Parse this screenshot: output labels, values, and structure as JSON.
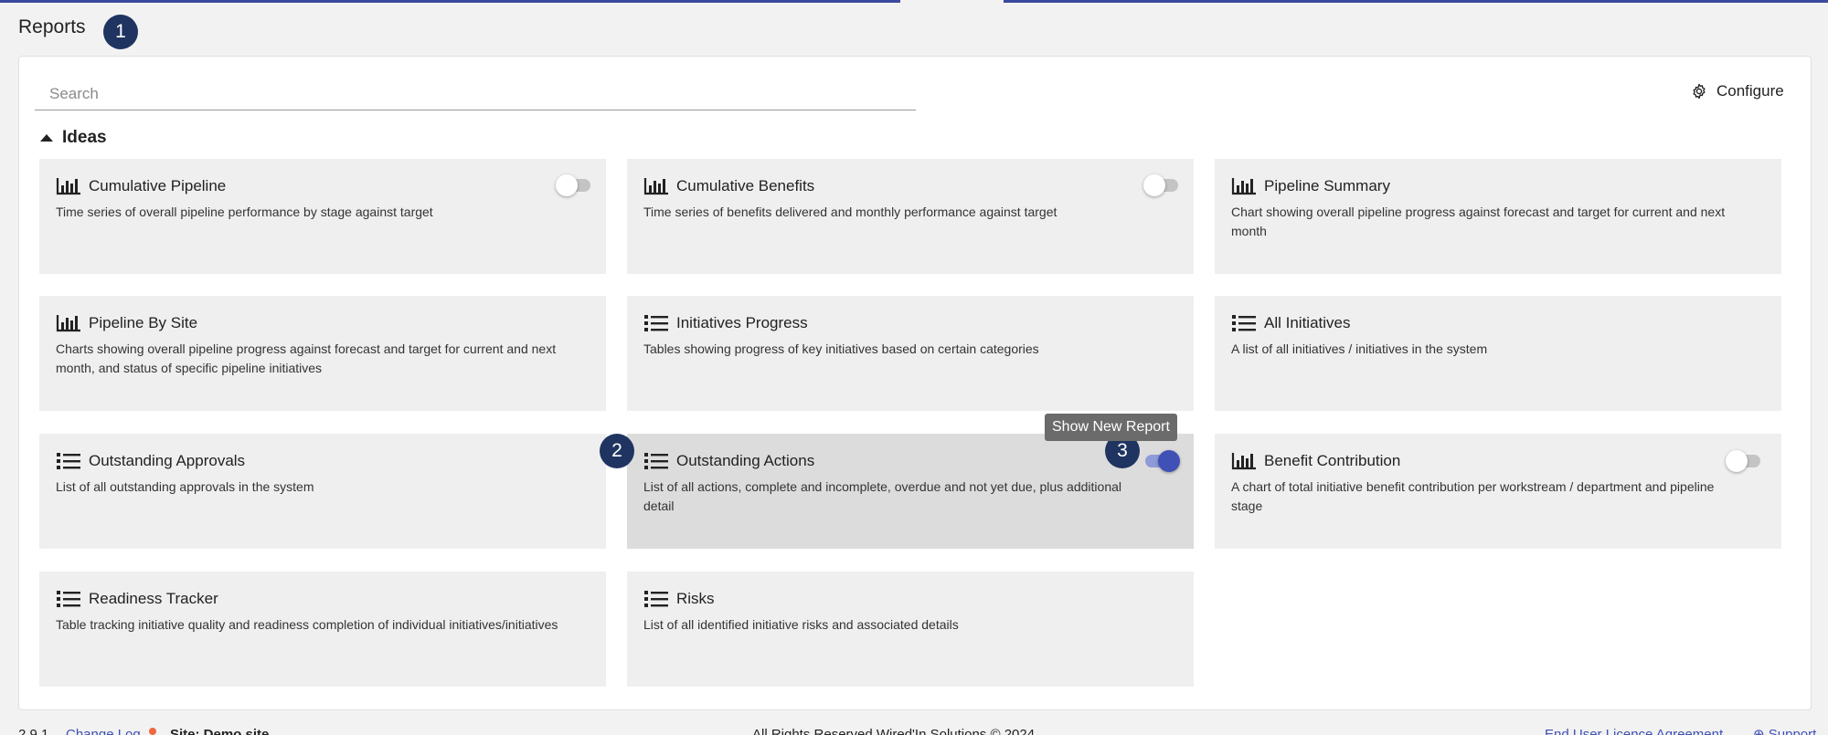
{
  "page": {
    "title": "Reports"
  },
  "steps": [
    "1",
    "2",
    "3"
  ],
  "search": {
    "placeholder": "Search",
    "value": ""
  },
  "toolbar": {
    "configure_label": "Configure",
    "configure_icon": "gear-icon"
  },
  "section": {
    "label": "Ideas",
    "expanded": true
  },
  "cards": [
    {
      "title": "Cumulative Pipeline",
      "description": "Time series of overall pipeline performance by stage against target",
      "icon": "bar-chart-icon",
      "toggle": "off"
    },
    {
      "title": "Cumulative Benefits",
      "description": "Time series of benefits delivered and monthly performance against target",
      "icon": "bar-chart-icon",
      "toggle": "off"
    },
    {
      "title": "Pipeline Summary",
      "description": "Chart showing overall pipeline progress against forecast and target for current and next month",
      "icon": "bar-chart-icon",
      "toggle": "none"
    },
    {
      "title": "Pipeline By Site",
      "description": "Charts showing overall pipeline progress against forecast and target for current and next month, and status of specific pipeline initiatives",
      "icon": "bar-chart-icon",
      "toggle": "none"
    },
    {
      "title": "Initiatives Progress",
      "description": "Tables showing progress of key initiatives based on certain categories",
      "icon": "list-icon",
      "toggle": "none"
    },
    {
      "title": "All Initiatives",
      "description": "A list of all initiatives / initiatives in the system",
      "icon": "list-icon",
      "toggle": "none"
    },
    {
      "title": "Outstanding Approvals",
      "description": "List of all outstanding approvals in the system",
      "icon": "list-icon",
      "toggle": "none"
    },
    {
      "title": "Outstanding Actions",
      "description": "List of all actions, complete and incomplete, overdue and not yet due, plus additional detail",
      "icon": "list-icon",
      "toggle": "on"
    },
    {
      "title": "Benefit Contribution",
      "description": "A chart of total initiative benefit contribution per workstream / department and pipeline stage",
      "icon": "bar-chart-icon",
      "toggle": "off"
    },
    {
      "title": "Readiness Tracker",
      "description": "Table tracking initiative quality and readiness completion of individual initiatives/initiatives",
      "icon": "list-icon",
      "toggle": "none"
    },
    {
      "title": "Risks",
      "description": "List of all identified initiative risks and associated details",
      "icon": "list-icon",
      "toggle": "none"
    }
  ],
  "tooltip": {
    "text": "Show New Report"
  },
  "colors": {
    "accent": "#3f51b5",
    "badge": "#1f3460",
    "card_bg": "#efefef",
    "card_hover_bg": "#dcdcdc",
    "changelog_dot": "#f0683c"
  },
  "footer": {
    "version": "2.9.1",
    "changelog_label": "Change Log",
    "site_label": "Site: Demo site",
    "copyright": "All Rights Reserved Wired'In Solutions © 2024",
    "eula_label": "End User Licence Agreement",
    "support_label": "Support"
  }
}
